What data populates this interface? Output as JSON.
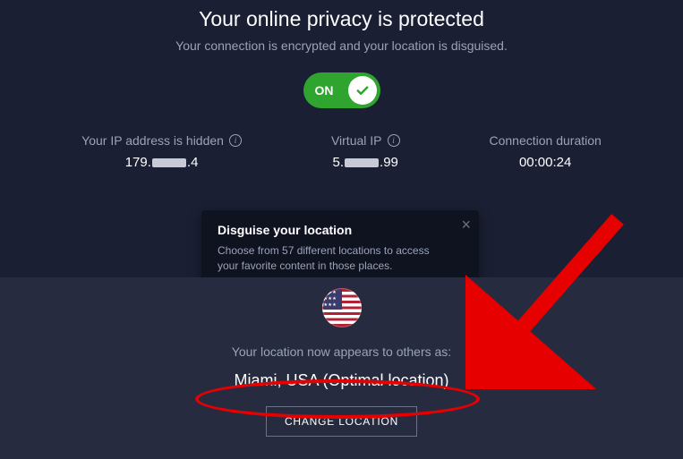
{
  "header": {
    "title": "Your online privacy is protected",
    "subtitle": "Your connection is encrypted and your location is disguised."
  },
  "toggle": {
    "label": "ON"
  },
  "stats": {
    "ip_hidden": {
      "label": "Your IP address is hidden",
      "prefix": "179.",
      "suffix": ".4"
    },
    "virtual_ip": {
      "label": "Virtual IP",
      "prefix": "5.",
      "suffix": ".99"
    },
    "duration": {
      "label": "Connection duration",
      "value": "00:00:24"
    }
  },
  "tooltip": {
    "title": "Disguise your location",
    "body": "Choose from 57 different locations to access your favorite content in those places."
  },
  "location": {
    "appears_label": "Your location now appears to others as:",
    "value": "Miami, USA (Optimal location)",
    "change_button": "CHANGE LOCATION"
  }
}
